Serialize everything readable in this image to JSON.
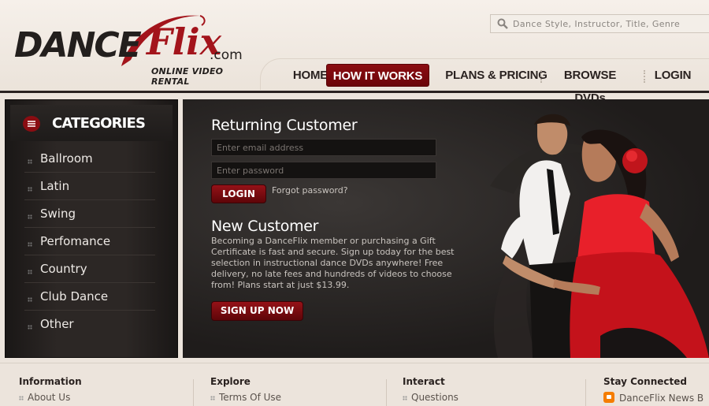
{
  "brand": {
    "name_dance": "DANCE",
    "name_flix": "Flix",
    "name_com": ".com",
    "tagline": "ONLINE VIDEO RENTAL",
    "accent": "#a3141b"
  },
  "search": {
    "placeholder": "Dance Style, Instructor, Title, Genre",
    "icon": "search-icon"
  },
  "nav": {
    "items": [
      {
        "label": "HOME"
      },
      {
        "label": "HOW IT WORKS",
        "active": true
      },
      {
        "label": "PLANS & PRICING"
      },
      {
        "label": "BROWSE DVDs"
      },
      {
        "label": "LOGIN"
      }
    ]
  },
  "categories": {
    "title": "CATEGORIES",
    "items": [
      {
        "label": "Ballroom"
      },
      {
        "label": "Latin"
      },
      {
        "label": "Swing"
      },
      {
        "label": "Perfomance"
      },
      {
        "label": "Country"
      },
      {
        "label": "Club Dance"
      },
      {
        "label": "Other"
      }
    ]
  },
  "returning": {
    "title": "Returning Customer",
    "email_placeholder": "Enter email address",
    "password_placeholder": "Enter password",
    "login_label": "LOGIN",
    "forgot_label": "Forgot password?"
  },
  "new_customer": {
    "title": "New Customer",
    "text": "Becoming a DanceFlix member or purchasing a Gift Certificate is fast and secure. Sign up today for the best selection in instructional dance DVDs anywhere! Free delivery, no late fees and hundreds of videos to choose from! Plans start at just $13.99.",
    "signup_label": "SIGN UP NOW"
  },
  "footer": {
    "columns": [
      {
        "title": "Information",
        "link": "About Us"
      },
      {
        "title": "Explore",
        "link": "Terms Of Use"
      },
      {
        "title": "Interact",
        "link": "Questions"
      },
      {
        "title": "Stay Connected",
        "link": "DanceFlix News B"
      }
    ]
  }
}
